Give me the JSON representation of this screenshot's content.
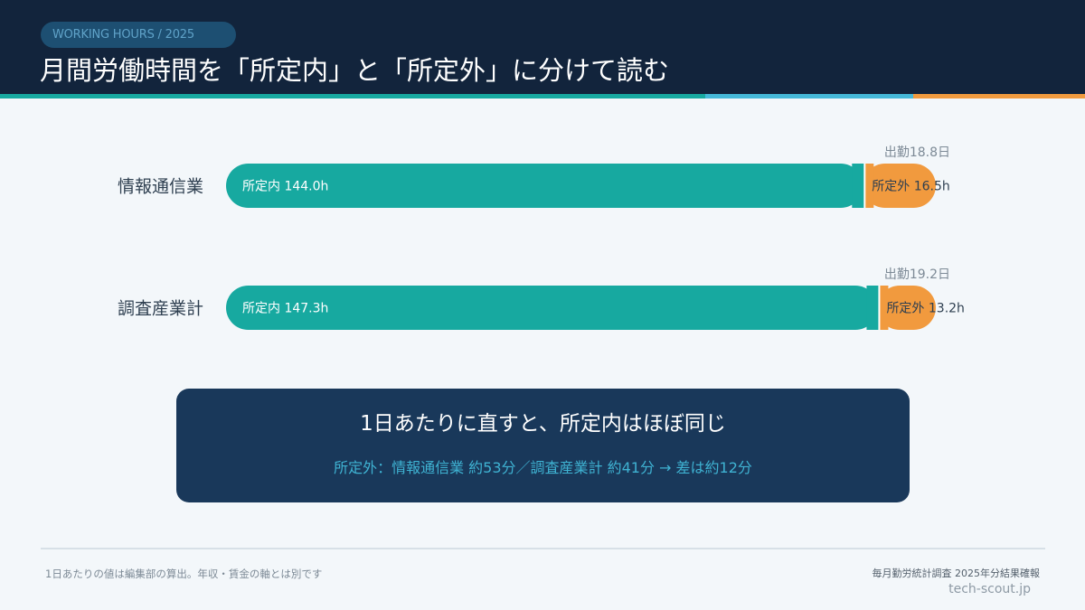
{
  "header": {
    "badge": "WORKING HOURS / 2025",
    "title": "月間労働時間を「所定内」と「所定外」に分けて読む",
    "stripe_colors": [
      "#17a9a0",
      "#45b8d8",
      "#f19a3e"
    ]
  },
  "chart_data": {
    "type": "bar",
    "orientation": "horizontal",
    "stacked": true,
    "categories": [
      "情報通信業",
      "調査産業計"
    ],
    "series": [
      {
        "name": "所定内",
        "values": [
          144.0,
          147.3
        ],
        "color": "#17a9a0"
      },
      {
        "name": "所定外",
        "values": [
          16.5,
          13.2
        ],
        "color": "#f19a3e"
      }
    ],
    "unit": "h",
    "bar_labels": [
      [
        "所定内 144.0h",
        "所定外 16.5h"
      ],
      [
        "所定内 147.3h",
        "所定外 13.2h"
      ]
    ],
    "annotations": [
      "出勤18.8日",
      "出勤19.2日"
    ],
    "attendance_days": [
      18.8,
      19.2
    ],
    "xlim": [
      0,
      160.5
    ],
    "grid": false,
    "legend": "none"
  },
  "summary": {
    "headline": "1日あたりに直すと、所定内はほぼ同じ",
    "detail": "所定外：情報通信業 約53分／調査産業計 約41分 → 差は約12分"
  },
  "footer": {
    "note": "1日あたりの値は編集部の算出。年収・賃金の軸とは別です",
    "source": "毎月勤労統計調査 2025年分結果確報",
    "site": "tech-scout.jp"
  }
}
